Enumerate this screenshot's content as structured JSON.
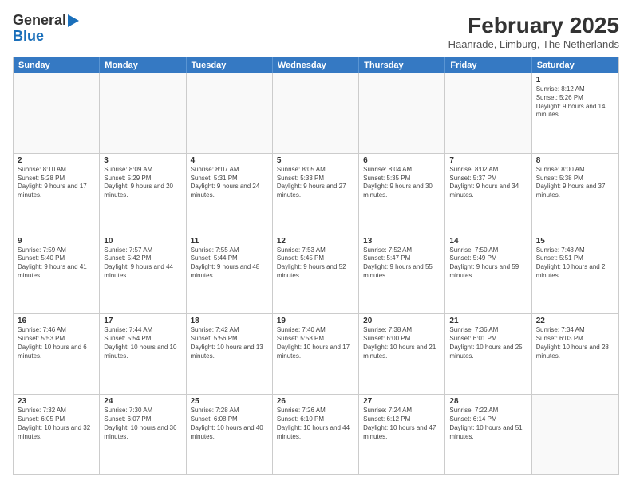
{
  "logo": {
    "line1": "General",
    "line2": "Blue"
  },
  "header": {
    "title": "February 2025",
    "subtitle": "Haanrade, Limburg, The Netherlands"
  },
  "weekdays": [
    "Sunday",
    "Monday",
    "Tuesday",
    "Wednesday",
    "Thursday",
    "Friday",
    "Saturday"
  ],
  "rows": [
    [
      {
        "day": "",
        "info": ""
      },
      {
        "day": "",
        "info": ""
      },
      {
        "day": "",
        "info": ""
      },
      {
        "day": "",
        "info": ""
      },
      {
        "day": "",
        "info": ""
      },
      {
        "day": "",
        "info": ""
      },
      {
        "day": "1",
        "info": "Sunrise: 8:12 AM\nSunset: 5:26 PM\nDaylight: 9 hours and 14 minutes."
      }
    ],
    [
      {
        "day": "2",
        "info": "Sunrise: 8:10 AM\nSunset: 5:28 PM\nDaylight: 9 hours and 17 minutes."
      },
      {
        "day": "3",
        "info": "Sunrise: 8:09 AM\nSunset: 5:29 PM\nDaylight: 9 hours and 20 minutes."
      },
      {
        "day": "4",
        "info": "Sunrise: 8:07 AM\nSunset: 5:31 PM\nDaylight: 9 hours and 24 minutes."
      },
      {
        "day": "5",
        "info": "Sunrise: 8:05 AM\nSunset: 5:33 PM\nDaylight: 9 hours and 27 minutes."
      },
      {
        "day": "6",
        "info": "Sunrise: 8:04 AM\nSunset: 5:35 PM\nDaylight: 9 hours and 30 minutes."
      },
      {
        "day": "7",
        "info": "Sunrise: 8:02 AM\nSunset: 5:37 PM\nDaylight: 9 hours and 34 minutes."
      },
      {
        "day": "8",
        "info": "Sunrise: 8:00 AM\nSunset: 5:38 PM\nDaylight: 9 hours and 37 minutes."
      }
    ],
    [
      {
        "day": "9",
        "info": "Sunrise: 7:59 AM\nSunset: 5:40 PM\nDaylight: 9 hours and 41 minutes."
      },
      {
        "day": "10",
        "info": "Sunrise: 7:57 AM\nSunset: 5:42 PM\nDaylight: 9 hours and 44 minutes."
      },
      {
        "day": "11",
        "info": "Sunrise: 7:55 AM\nSunset: 5:44 PM\nDaylight: 9 hours and 48 minutes."
      },
      {
        "day": "12",
        "info": "Sunrise: 7:53 AM\nSunset: 5:45 PM\nDaylight: 9 hours and 52 minutes."
      },
      {
        "day": "13",
        "info": "Sunrise: 7:52 AM\nSunset: 5:47 PM\nDaylight: 9 hours and 55 minutes."
      },
      {
        "day": "14",
        "info": "Sunrise: 7:50 AM\nSunset: 5:49 PM\nDaylight: 9 hours and 59 minutes."
      },
      {
        "day": "15",
        "info": "Sunrise: 7:48 AM\nSunset: 5:51 PM\nDaylight: 10 hours and 2 minutes."
      }
    ],
    [
      {
        "day": "16",
        "info": "Sunrise: 7:46 AM\nSunset: 5:53 PM\nDaylight: 10 hours and 6 minutes."
      },
      {
        "day": "17",
        "info": "Sunrise: 7:44 AM\nSunset: 5:54 PM\nDaylight: 10 hours and 10 minutes."
      },
      {
        "day": "18",
        "info": "Sunrise: 7:42 AM\nSunset: 5:56 PM\nDaylight: 10 hours and 13 minutes."
      },
      {
        "day": "19",
        "info": "Sunrise: 7:40 AM\nSunset: 5:58 PM\nDaylight: 10 hours and 17 minutes."
      },
      {
        "day": "20",
        "info": "Sunrise: 7:38 AM\nSunset: 6:00 PM\nDaylight: 10 hours and 21 minutes."
      },
      {
        "day": "21",
        "info": "Sunrise: 7:36 AM\nSunset: 6:01 PM\nDaylight: 10 hours and 25 minutes."
      },
      {
        "day": "22",
        "info": "Sunrise: 7:34 AM\nSunset: 6:03 PM\nDaylight: 10 hours and 28 minutes."
      }
    ],
    [
      {
        "day": "23",
        "info": "Sunrise: 7:32 AM\nSunset: 6:05 PM\nDaylight: 10 hours and 32 minutes."
      },
      {
        "day": "24",
        "info": "Sunrise: 7:30 AM\nSunset: 6:07 PM\nDaylight: 10 hours and 36 minutes."
      },
      {
        "day": "25",
        "info": "Sunrise: 7:28 AM\nSunset: 6:08 PM\nDaylight: 10 hours and 40 minutes."
      },
      {
        "day": "26",
        "info": "Sunrise: 7:26 AM\nSunset: 6:10 PM\nDaylight: 10 hours and 44 minutes."
      },
      {
        "day": "27",
        "info": "Sunrise: 7:24 AM\nSunset: 6:12 PM\nDaylight: 10 hours and 47 minutes."
      },
      {
        "day": "28",
        "info": "Sunrise: 7:22 AM\nSunset: 6:14 PM\nDaylight: 10 hours and 51 minutes."
      },
      {
        "day": "",
        "info": ""
      }
    ]
  ]
}
